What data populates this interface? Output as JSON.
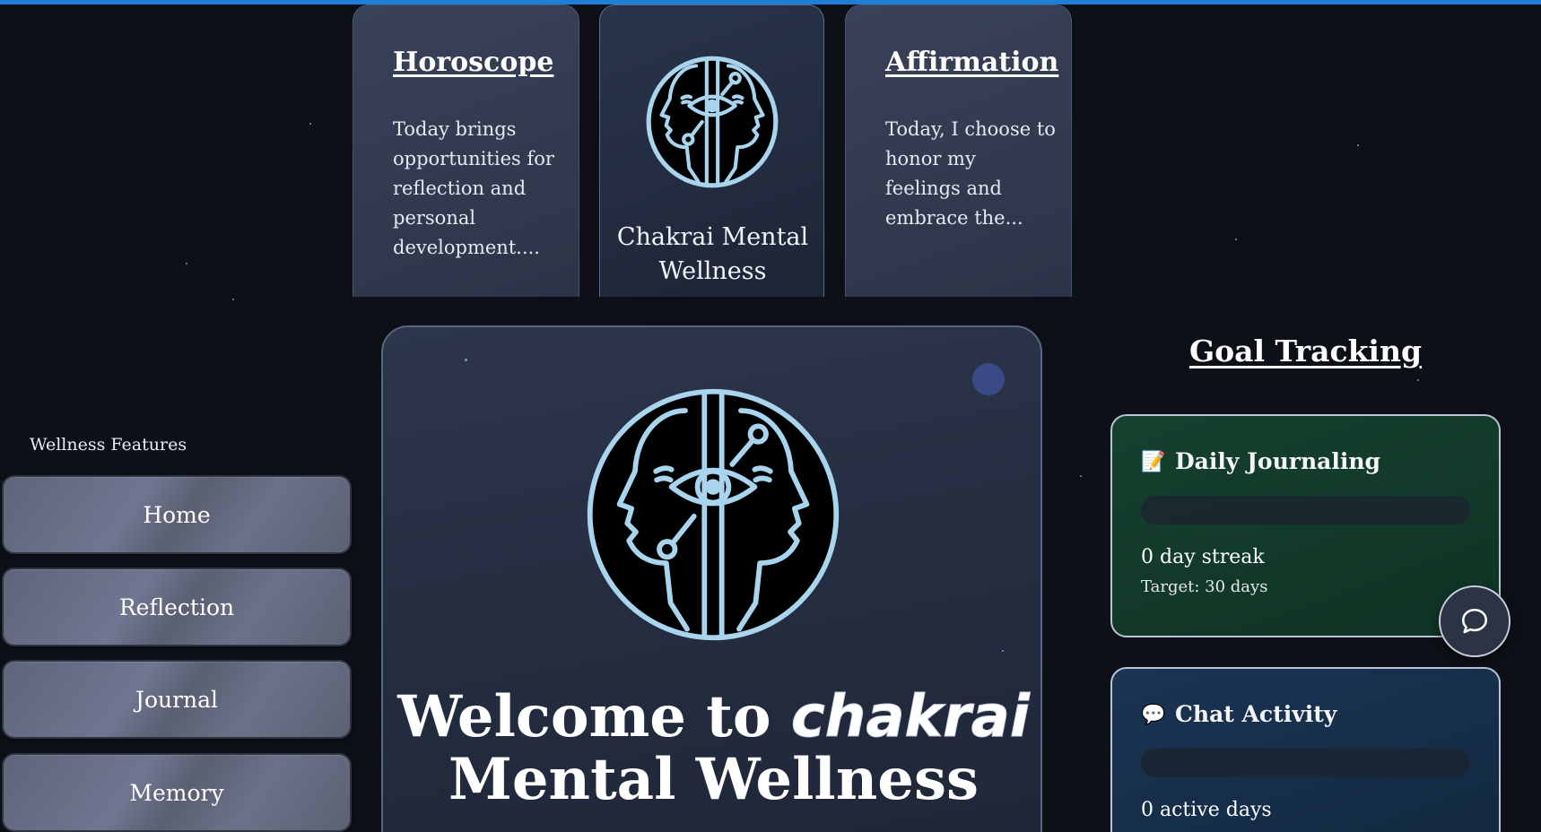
{
  "top_cards": {
    "horoscope": {
      "title": "Horoscope",
      "text": "Today brings opportunities for reflection and personal development...."
    },
    "center": {
      "title": "Chakrai Mental Wellness",
      "logo_icon": "twin-faces-eye-icon"
    },
    "affirmation": {
      "title": "Affirmation",
      "text": "Today, I choose to honor my feelings and embrace the..."
    }
  },
  "sidebar": {
    "title": "Wellness Features",
    "items": [
      {
        "label": "Home"
      },
      {
        "label": "Reflection"
      },
      {
        "label": "Journal"
      },
      {
        "label": "Memory"
      }
    ]
  },
  "hero": {
    "title_prefix": "Welcome to ",
    "brand": "chakrai",
    "title_suffix": "Mental Wellness",
    "logo_icon": "twin-faces-eye-icon"
  },
  "goals": {
    "title": "Goal Tracking",
    "cards": [
      {
        "emoji": "📝",
        "title": "Daily Journaling",
        "streak": "0 day streak",
        "target": "Target: 30 days",
        "progress": 0
      },
      {
        "emoji": "💬",
        "title": "Chat Activity",
        "streak": "0 active days",
        "target": "",
        "progress": 0
      }
    ]
  },
  "chat_fab": {
    "icon": "chat-bubble-icon"
  },
  "colors": {
    "background": "#0d1117",
    "top_bar": "#1f7fd6",
    "logo_stroke": "#a8d4ee",
    "journaling_card": "#123a2a",
    "chat_card": "#16304c"
  }
}
